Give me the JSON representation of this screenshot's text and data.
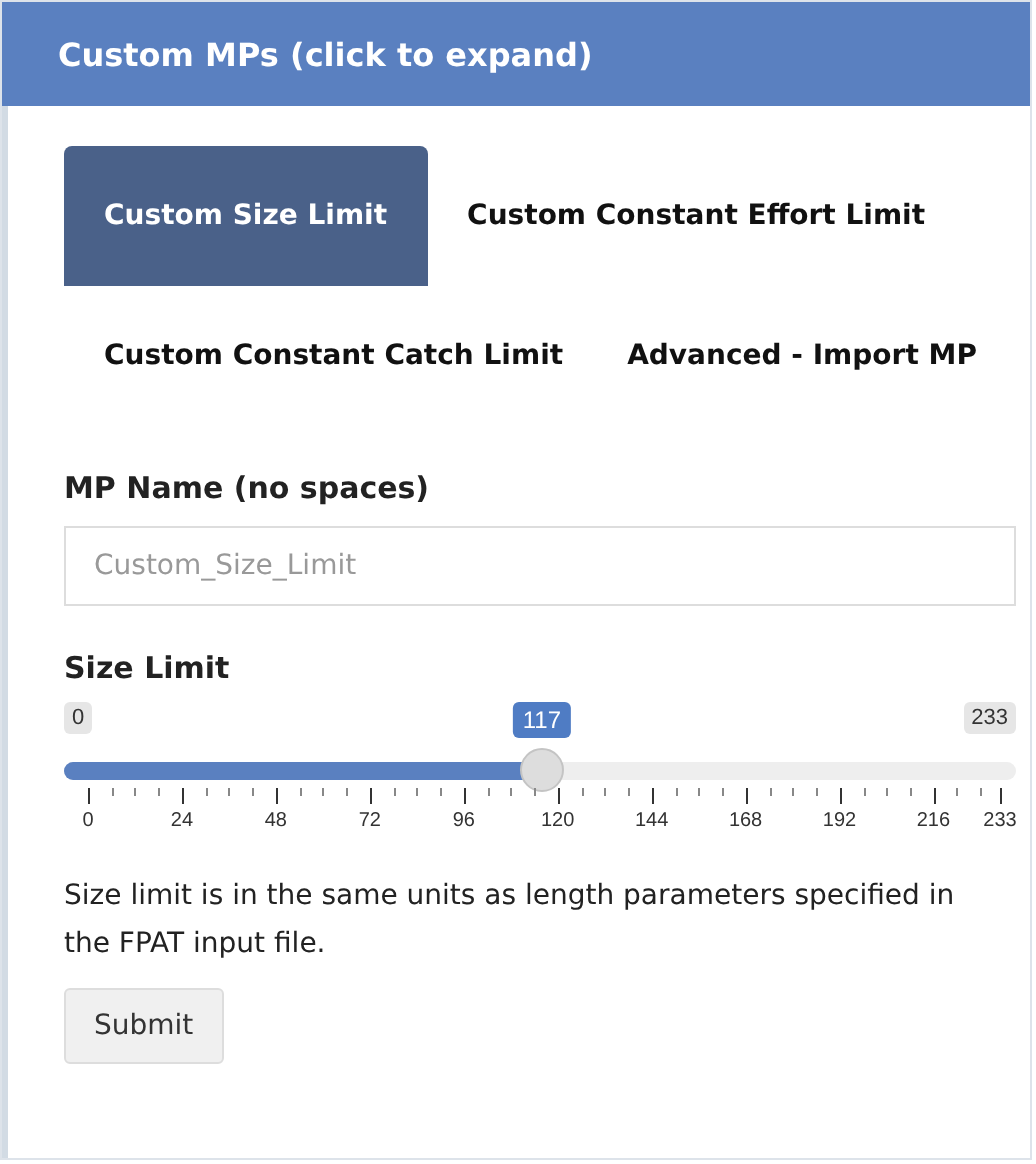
{
  "panel": {
    "title": "Custom MPs (click to expand)"
  },
  "tabs": [
    {
      "label": "Custom Size Limit",
      "selected": true
    },
    {
      "label": "Custom Constant Effort Limit",
      "selected": false
    },
    {
      "label": "Custom Constant Catch Limit",
      "selected": false
    },
    {
      "label": "Advanced - Import MP",
      "selected": false
    }
  ],
  "name_field": {
    "label": "MP Name (no spaces)",
    "placeholder": "Custom_Size_Limit"
  },
  "slider": {
    "label": "Size Limit",
    "min": "0",
    "max": "233",
    "value": "117",
    "level": 0.502,
    "ticks": [
      "0",
      "24",
      "48",
      "72",
      "96",
      "120",
      "144",
      "168",
      "192",
      "216",
      "233"
    ]
  },
  "help_text": "Size limit is in the same units as length parameters specified in the FPAT input file.",
  "buttons": [
    "Submit"
  ]
}
